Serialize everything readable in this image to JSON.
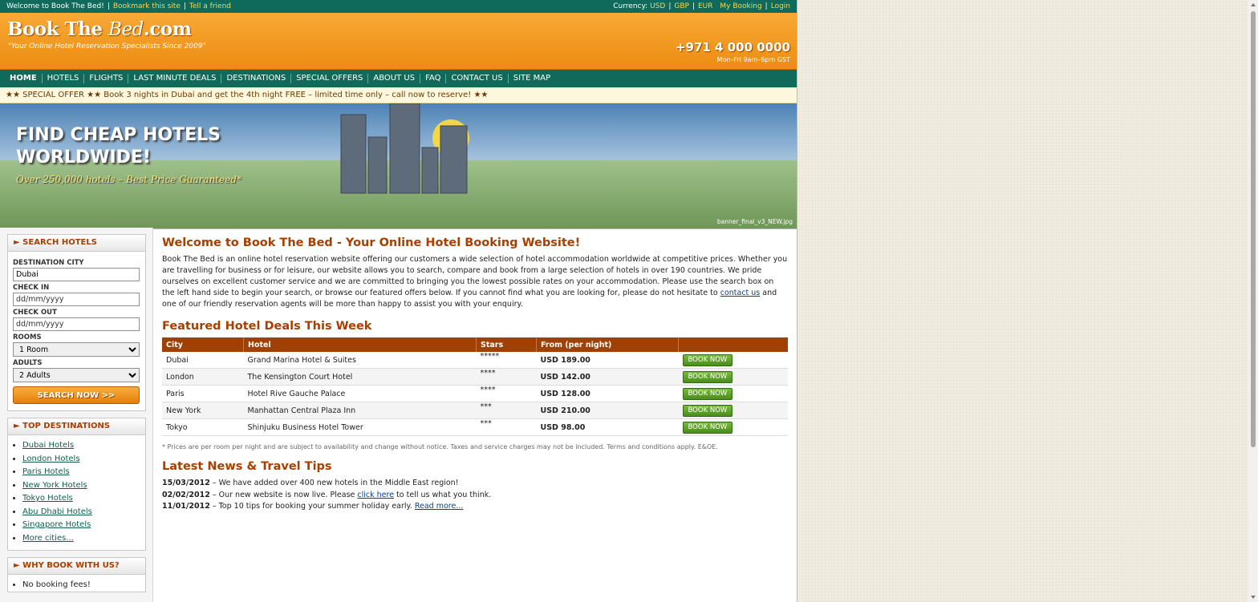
{
  "topbar": {
    "welcome": "Welcome to Book The Bed!",
    "bookmark": "Bookmark this site",
    "tell_friend": "Tell a friend",
    "currency_label": "Currency:",
    "currencies": [
      "USD",
      "GBP",
      "EUR"
    ],
    "my_booking": "My Booking",
    "login": "Login"
  },
  "header": {
    "logo_main": "Book The ",
    "logo_italic": "Bed",
    "logo_tld": ".com",
    "tagline": "\"Your Online Hotel Reservation Specialists Since 2009\"",
    "phone": "+971 4 000 0000",
    "hours": "Mon–Fri 9am–6pm GST"
  },
  "nav": {
    "items": [
      "HOME",
      "HOTELS",
      "FLIGHTS",
      "LAST MINUTE DEALS",
      "DESTINATIONS",
      "SPECIAL OFFERS",
      "ABOUT US",
      "FAQ",
      "CONTACT US",
      "SITE MAP"
    ],
    "active": "HOME"
  },
  "promo": "★★ SPECIAL OFFER ★★ Book 3 nights in Dubai and get the 4th night FREE – limited time only – call now to reserve! ★★",
  "banner": {
    "title": "FIND CHEAP HOTELS WORLDWIDE!",
    "subtitle": "Over 250,000 hotels – Best Price Guaranteed*",
    "file_label": "banner_final_v3_NEW.jpg"
  },
  "search": {
    "heading": "► SEARCH HOTELS",
    "dest_label": "DESTINATION CITY",
    "dest_value": "Dubai",
    "checkin_label": "CHECK IN",
    "checkin_placeholder": "dd/mm/yyyy",
    "checkout_label": "CHECK OUT",
    "checkout_placeholder": "dd/mm/yyyy",
    "rooms_label": "ROOMS",
    "rooms_value": "1 Room",
    "adults_label": "ADULTS",
    "adults_value": "2 Adults",
    "button": "SEARCH NOW >>"
  },
  "destinations": {
    "heading": "► TOP DESTINATIONS",
    "items": [
      "Dubai Hotels",
      "London Hotels",
      "Paris Hotels",
      "New York Hotels",
      "Tokyo Hotels",
      "Abu Dhabi Hotels",
      "Singapore Hotels",
      "More cities..."
    ]
  },
  "why": {
    "heading": "► WHY BOOK WITH US?",
    "items": [
      "No booking fees!"
    ]
  },
  "main": {
    "welcome_heading": "Welcome to Book The Bed - Your Online Hotel Booking Website!",
    "intro_before_link": "Book The Bed is an online hotel reservation website offering our customers a wide selection of hotel accommodation worldwide at competitive prices. Whether you are travelling for business or for leisure, our website allows you to search, compare and book from a large selection of hotels in over 190 countries. We pride ourselves on excellent customer service and we are committed to bringing you the lowest possible rates on your accommodation. Please use the search box on the left hand side to begin your search, or browse our featured offers below. If you cannot find what you are looking for, please do not hesitate to ",
    "intro_link": "contact us",
    "intro_after_link": " and one of our friendly reservation agents will be more than happy to assist you with your enquiry.",
    "deals_heading": "Featured Hotel Deals This Week",
    "columns": [
      "City",
      "Hotel",
      "Stars",
      "From (per night)",
      ""
    ],
    "deals": [
      {
        "city": "Dubai",
        "hotel": "Grand Marina Hotel & Suites",
        "stars": "*****",
        "price": "USD 189.00",
        "button": "BOOK NOW"
      },
      {
        "city": "London",
        "hotel": "The Kensington Court Hotel",
        "stars": "****",
        "price": "USD 142.00",
        "button": "BOOK NOW"
      },
      {
        "city": "Paris",
        "hotel": "Hotel Rive Gauche Palace",
        "stars": "****",
        "price": "USD 128.00",
        "button": "BOOK NOW"
      },
      {
        "city": "New York",
        "hotel": "Manhattan Central Plaza Inn",
        "stars": "***",
        "price": "USD 210.00",
        "button": "BOOK NOW"
      },
      {
        "city": "Tokyo",
        "hotel": "Shinjuku Business Hotel Tower",
        "stars": "***",
        "price": "USD 98.00",
        "button": "BOOK NOW"
      }
    ],
    "disclaimer": "* Prices are per room per night and are subject to availability and change without notice. Taxes and service charges may not be included. Terms and conditions apply. E&OE.",
    "news_heading": "Latest News & Travel Tips",
    "news": [
      {
        "date": "15/03/2012",
        "text": " – We have added over 400 new hotels in the Middle East region!"
      },
      {
        "date": "02/02/2012",
        "text": " – Our new website is now live. Please ",
        "link": "click here",
        "after": " to tell us what you think."
      },
      {
        "date": "11/01/2012",
        "text": " – Top 10 tips for booking your summer holiday early. ",
        "link": "Read more..."
      }
    ]
  },
  "colors": {
    "brand_green": "#0f6a5b",
    "brand_orange": "#ed8c12",
    "heading_rust": "#a83f00",
    "price_red": "#b30000"
  }
}
